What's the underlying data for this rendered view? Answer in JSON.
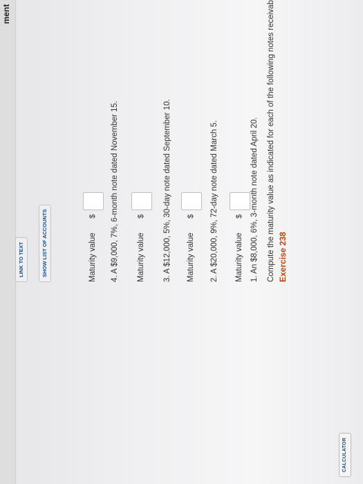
{
  "header": {
    "title": "ment"
  },
  "toolbar": {
    "calculator_label": "CALCULATOR"
  },
  "exercise": {
    "title": "Exercise 238",
    "instructions": "Compute the maturity value as indicated for each of the following notes receivable.",
    "items": [
      {
        "prompt": "1. An $8,000, 6%, 3-month note dated April 20.",
        "field_label": "Maturity value",
        "currency": "$",
        "value": ""
      },
      {
        "prompt": "2. A $20,000, 9%, 72-day note dated March 5.",
        "field_label": "Maturity value",
        "currency": "$",
        "value": ""
      },
      {
        "prompt": "3. A $12,000, 5%, 30-day note dated September 10.",
        "field_label": "Maturity value",
        "currency": "$",
        "value": ""
      },
      {
        "prompt": "4. A $9,000, 7%, 6-month note dated November 15.",
        "field_label": "Maturity value",
        "currency": "$",
        "value": ""
      }
    ]
  },
  "links": {
    "show_accounts": "SHOW LIST OF ACCOUNTS",
    "link_to_text": "LINK TO TEXT"
  },
  "colors": {
    "exercise_title": "#c2410c",
    "link_text": "#1f4e8a"
  }
}
